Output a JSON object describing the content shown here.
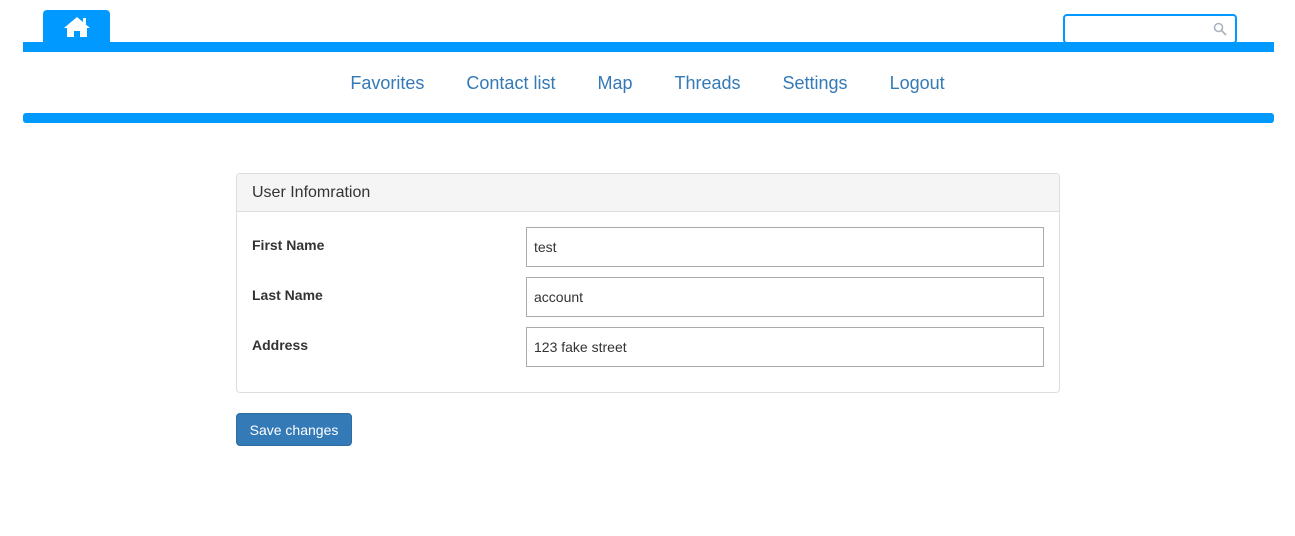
{
  "header": {
    "home_icon": "home-icon",
    "search": {
      "value": "",
      "placeholder": "",
      "icon": "search-icon"
    }
  },
  "nav": {
    "items": [
      {
        "label": "Favorites"
      },
      {
        "label": "Contact list"
      },
      {
        "label": "Map"
      },
      {
        "label": "Threads"
      },
      {
        "label": "Settings"
      },
      {
        "label": "Logout"
      }
    ]
  },
  "panel": {
    "title": "User Infomration",
    "fields": [
      {
        "label": "First Name",
        "value": "test"
      },
      {
        "label": "Last Name",
        "value": "account"
      },
      {
        "label": "Address",
        "value": "123 fake street"
      }
    ]
  },
  "actions": {
    "save_label": "Save changes"
  },
  "colors": {
    "accent": "#0099ff",
    "link": "#337ab7",
    "button": "#337ab7"
  }
}
